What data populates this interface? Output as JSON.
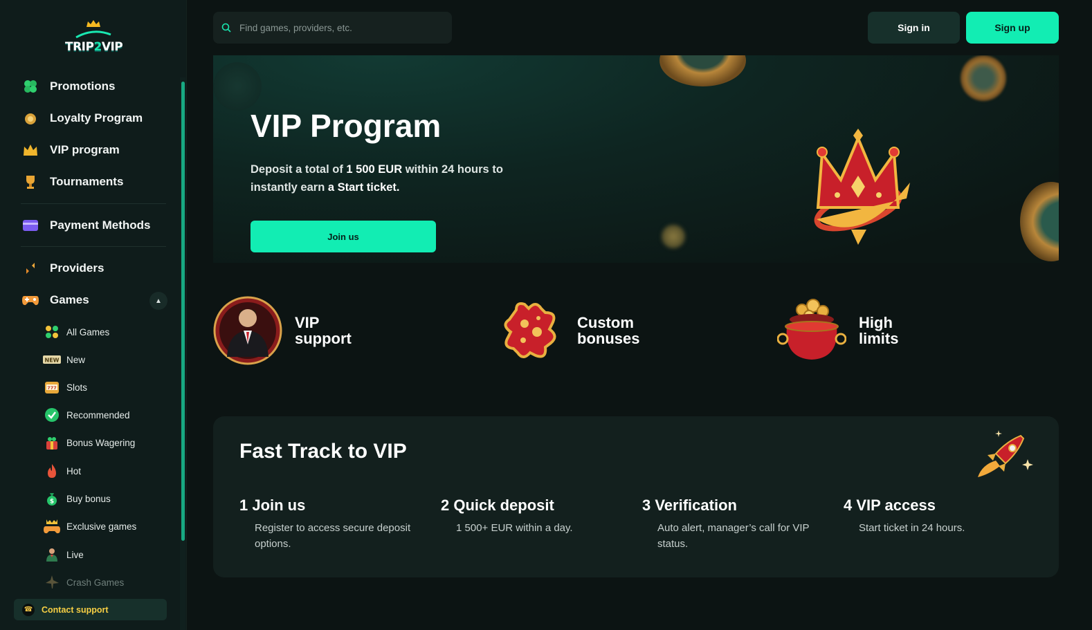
{
  "brand": {
    "logo_text_part1": "TRIP",
    "logo_text_part2": "2",
    "logo_text_part3": "VIP"
  },
  "header": {
    "search_placeholder": "Find games, providers, etc.",
    "signin_label": "Sign in",
    "signup_label": "Sign up"
  },
  "sidebar": {
    "main_items": [
      {
        "label": "Promotions",
        "icon": "clover-icon"
      },
      {
        "label": "Loyalty Program",
        "icon": "loyalty-icon"
      },
      {
        "label": "VIP program",
        "icon": "crown-icon"
      },
      {
        "label": "Tournaments",
        "icon": "trophy-icon"
      },
      {
        "label": "Payment Methods",
        "icon": "card-icon"
      },
      {
        "label": "Providers",
        "icon": "providers-icon"
      },
      {
        "label": "Games",
        "icon": "gamepad-icon"
      }
    ],
    "game_items": [
      {
        "label": "All Games",
        "icon": "grid-icon"
      },
      {
        "label": "New",
        "icon": "new-badge-icon"
      },
      {
        "label": "Slots",
        "icon": "slot-machine-icon"
      },
      {
        "label": "Recommended",
        "icon": "check-badge-icon"
      },
      {
        "label": "Bonus Wagering",
        "icon": "gift-icon"
      },
      {
        "label": "Hot",
        "icon": "fire-icon"
      },
      {
        "label": "Buy bonus",
        "icon": "money-bag-icon"
      },
      {
        "label": "Exclusive games",
        "icon": "exclusive-icon"
      },
      {
        "label": "Live",
        "icon": "dealer-icon"
      },
      {
        "label": "Crash Games",
        "icon": "plane-icon"
      }
    ],
    "contact_label": "Contact support"
  },
  "hero": {
    "title": "VIP Program",
    "text_part1": "Deposit a total of ",
    "text_amount": "1 500 EUR",
    "text_part2": " within 24 hours to instantly earn ",
    "text_ticket": "a Start ticket.",
    "join_label": "Join us"
  },
  "features": [
    {
      "line1": "VIP",
      "line2": "support"
    },
    {
      "line1": "Custom",
      "line2": "bonuses"
    },
    {
      "line1": "High",
      "line2": "limits"
    }
  ],
  "fast_track": {
    "title": "Fast Track to VIP",
    "steps": [
      {
        "title": "1 Join us",
        "desc": "Register to access secure deposit options."
      },
      {
        "title": "2 Quick deposit",
        "desc": "1 500+ EUR within a day."
      },
      {
        "title": "3 Verification",
        "desc": "Auto alert, manager’s call for VIP status."
      },
      {
        "title": "4 VIP access",
        "desc": "Start ticket in 24 hours."
      }
    ]
  },
  "colors": {
    "accent": "#12edb3",
    "bg": "#0c1413",
    "sidebar": "#0f1c1b",
    "contact_text": "#f7cf44"
  }
}
